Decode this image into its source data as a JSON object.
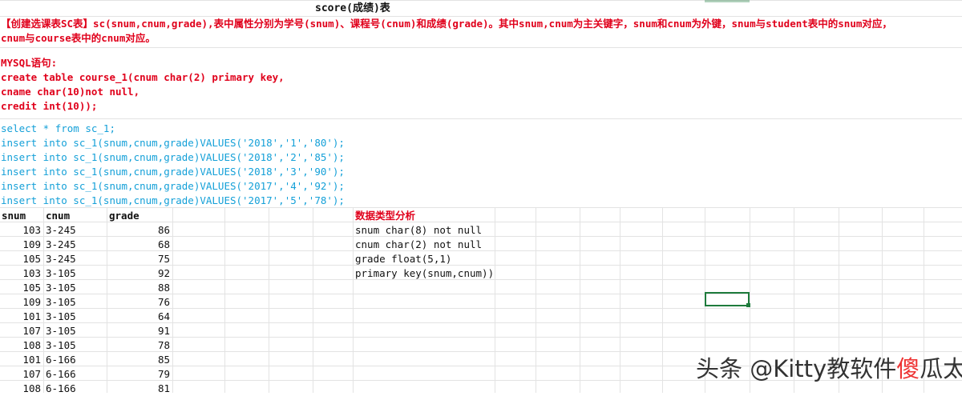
{
  "sheet": {
    "title": "score(成绩)表",
    "description_line1": "【创建选课表SC表】sc(snum,cnum,grade),表中属性分别为学号(snum)、课程号(cnum)和成绩(grade)。其中snum,cnum为主关键字，snum和cnum为外键，snum与student表中的snum对应，",
    "description_line2": "cnum与course表中的cnum对应。",
    "mysql_label": "MYSQL语句:",
    "create_lines": [
      "create table course_1(cnum char(2) primary key,",
      "cname char(10)not null,",
      "credit int(10));"
    ],
    "sql_lines": [
      "select * from sc_1;",
      "insert into sc_1(snum,cnum,grade)VALUES('2018','1','80');",
      "insert into sc_1(snum,cnum,grade)VALUES('2018','2','85');",
      "insert into sc_1(snum,cnum,grade)VALUES('2018','3','90');",
      "insert into sc_1(snum,cnum,grade)VALUES('2017','4','92');",
      "insert into sc_1(snum,cnum,grade)VALUES('2017','5','78');"
    ],
    "table": {
      "headers": [
        "snum",
        "cnum",
        "grade"
      ],
      "rows": [
        [
          "103",
          "3-245",
          "86"
        ],
        [
          "109",
          "3-245",
          "68"
        ],
        [
          "105",
          "3-245",
          "75"
        ],
        [
          "103",
          "3-105",
          "92"
        ],
        [
          "105",
          "3-105",
          "88"
        ],
        [
          "109",
          "3-105",
          "76"
        ],
        [
          "101",
          "3-105",
          "64"
        ],
        [
          "107",
          "3-105",
          "91"
        ],
        [
          "108",
          "3-105",
          "78"
        ],
        [
          "101",
          "6-166",
          "85"
        ],
        [
          "107",
          "6-166",
          "79"
        ],
        [
          "108",
          "6-166",
          "81"
        ]
      ]
    },
    "analysis": {
      "title": "数据类型分析",
      "lines": [
        "snum char(8) not null",
        "cnum char(2) not null",
        "grade float(5,1)",
        "primary key(snum,cnum))"
      ]
    }
  },
  "watermark": {
    "prefix": "头条 @Kitty教软件",
    "highlight": "傻",
    "suffix": "瓜太"
  }
}
